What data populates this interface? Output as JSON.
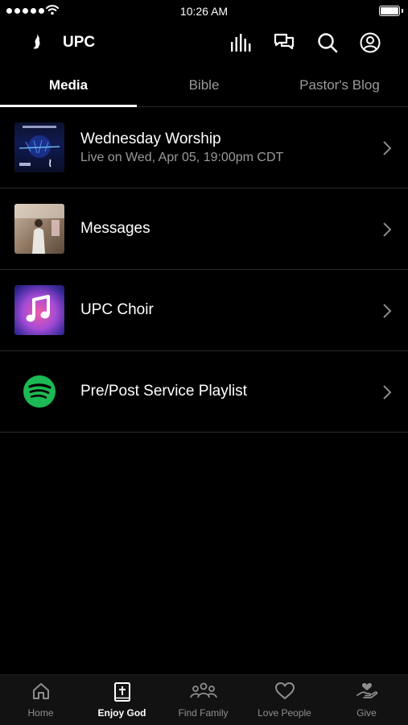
{
  "status_bar": {
    "time": "10:26 AM"
  },
  "header": {
    "title": "UPC",
    "icons": [
      "logo-flame-icon",
      "audio-bars-icon",
      "chat-icon",
      "search-icon",
      "account-icon"
    ]
  },
  "tabs": [
    {
      "label": "Media",
      "active": true
    },
    {
      "label": "Bible",
      "active": false
    },
    {
      "label": "Pastor's Blog",
      "active": false
    }
  ],
  "media_list": [
    {
      "title": "Wednesday Worship",
      "subtitle": "Live on Wed, Apr 05, 19:00pm CDT",
      "thumbnail": "worship-thumbnail"
    },
    {
      "title": "Messages",
      "subtitle": "",
      "thumbnail": "messages-thumbnail"
    },
    {
      "title": "UPC Choir",
      "subtitle": "",
      "thumbnail": "music-note-thumbnail"
    },
    {
      "title": "Pre/Post Service Playlist",
      "subtitle": "",
      "thumbnail": "spotify-icon"
    }
  ],
  "tab_bar": {
    "items": [
      {
        "label": "Home",
        "icon": "home-icon",
        "active": false
      },
      {
        "label": "Enjoy God",
        "icon": "bible-icon",
        "active": true
      },
      {
        "label": "Find Family",
        "icon": "people-icon",
        "active": false
      },
      {
        "label": "Love People",
        "icon": "heart-icon",
        "active": false
      },
      {
        "label": "Give",
        "icon": "give-hand-icon",
        "active": false
      }
    ]
  },
  "colors": {
    "background": "#000000",
    "text_primary": "#ffffff",
    "text_secondary": "#9a9a9a",
    "divider": "#2a2a2a",
    "spotify_green": "#1db954",
    "tab_bar_background": "#121212"
  }
}
